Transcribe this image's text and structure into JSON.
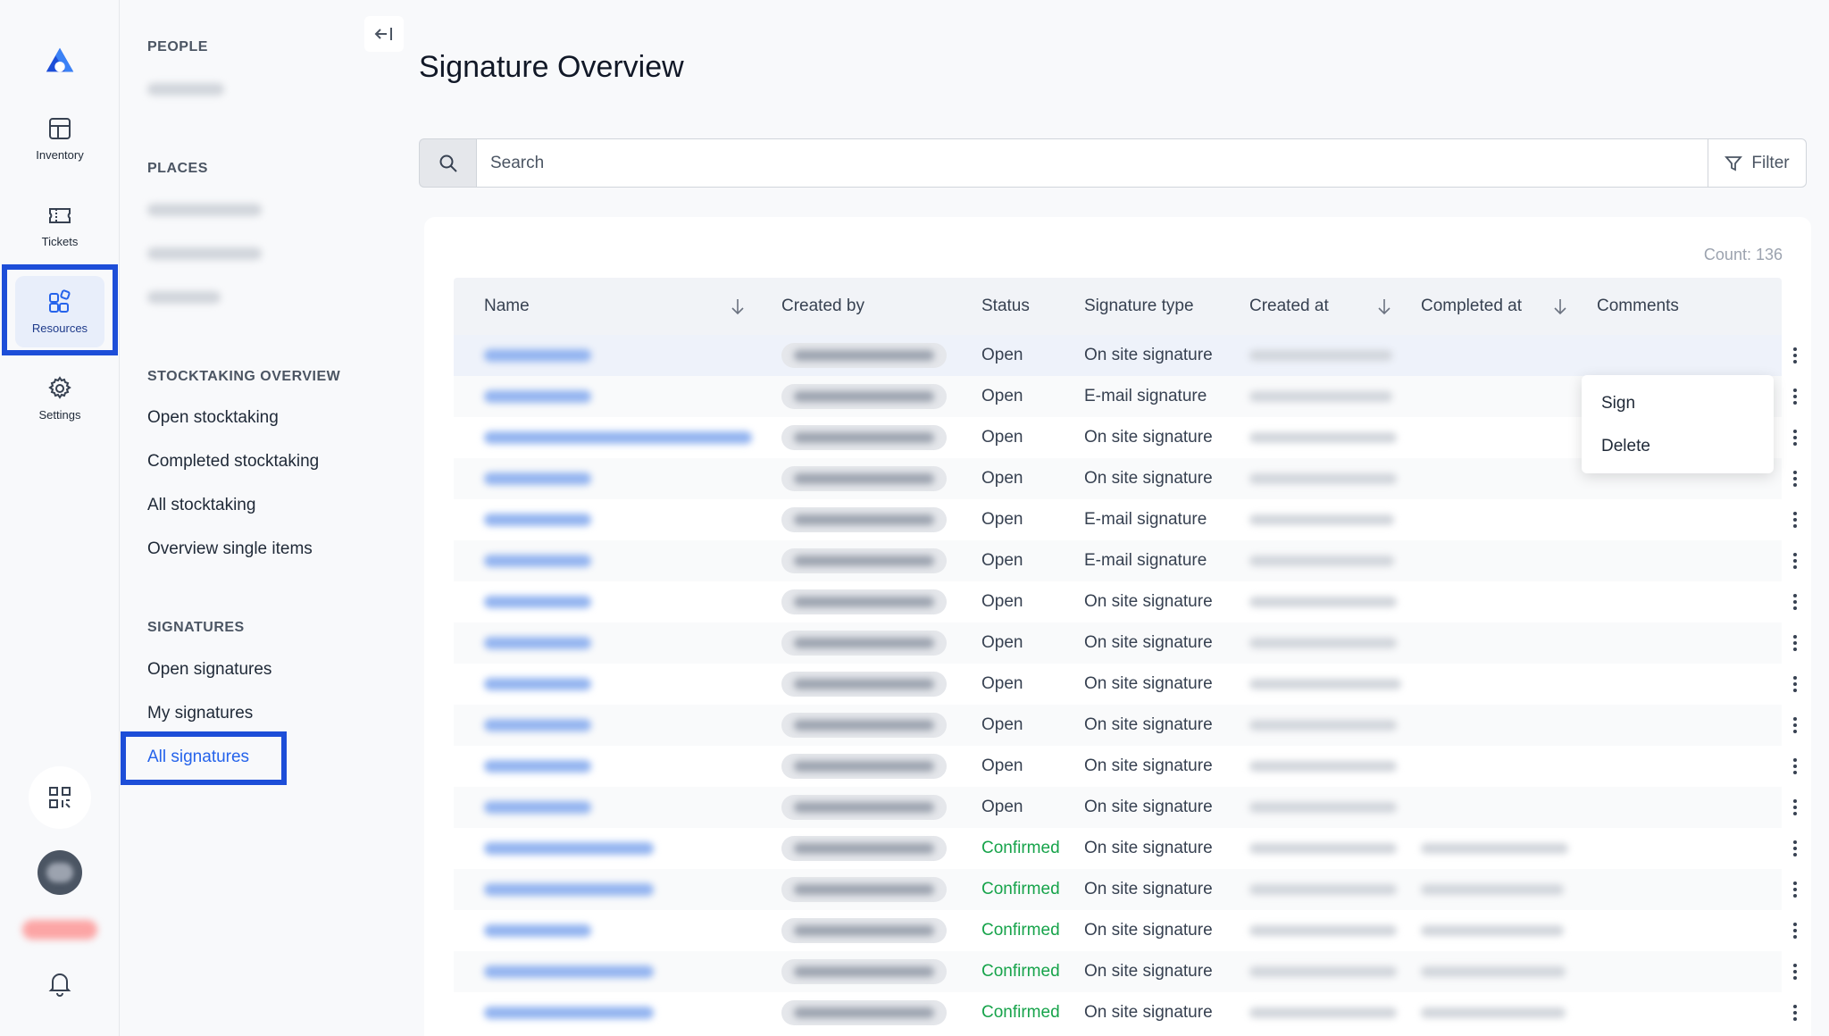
{
  "rail": {
    "items": [
      {
        "label": "Inventory",
        "icon": "inventory-icon"
      },
      {
        "label": "Tickets",
        "icon": "ticket-icon"
      },
      {
        "label": "Resources",
        "icon": "resources-icon",
        "active": true
      },
      {
        "label": "Settings",
        "icon": "gear-icon"
      }
    ]
  },
  "subnav": {
    "sections": {
      "people": "PEOPLE",
      "places": "PLACES",
      "stocktaking": "STOCKTAKING OVERVIEW",
      "signatures": "SIGNATURES"
    },
    "stocktaking_items": [
      "Open stocktaking",
      "Completed stocktaking",
      "All stocktaking",
      "Overview single items"
    ],
    "signature_items": [
      "Open signatures",
      "My signatures",
      "All signatures"
    ]
  },
  "page": {
    "title": "Signature Overview",
    "search_placeholder": "Search",
    "filter_label": "Filter",
    "count_label": "Count: 136"
  },
  "table": {
    "columns": [
      "Name",
      "Created by",
      "Status",
      "Signature type",
      "Created at",
      "Completed at",
      "Comments"
    ],
    "rows": [
      {
        "status": "Open",
        "type": "On site signature"
      },
      {
        "status": "Open",
        "type": "E-mail signature"
      },
      {
        "status": "Open",
        "type": "On site signature"
      },
      {
        "status": "Open",
        "type": "On site signature"
      },
      {
        "status": "Open",
        "type": "E-mail signature"
      },
      {
        "status": "Open",
        "type": "E-mail signature"
      },
      {
        "status": "Open",
        "type": "On site signature"
      },
      {
        "status": "Open",
        "type": "On site signature"
      },
      {
        "status": "Open",
        "type": "On site signature"
      },
      {
        "status": "Open",
        "type": "On site signature"
      },
      {
        "status": "Open",
        "type": "On site signature"
      },
      {
        "status": "Open",
        "type": "On site signature"
      },
      {
        "status": "Confirmed",
        "type": "On site signature"
      },
      {
        "status": "Confirmed",
        "type": "On site signature"
      },
      {
        "status": "Confirmed",
        "type": "On site signature"
      },
      {
        "status": "Confirmed",
        "type": "On site signature"
      },
      {
        "status": "Confirmed",
        "type": "On site signature"
      }
    ]
  },
  "context_menu": {
    "items": [
      "Sign",
      "Delete"
    ]
  },
  "colors": {
    "accent": "#2563eb",
    "highlight": "#1d4ed8",
    "confirmed": "#16a34a"
  }
}
